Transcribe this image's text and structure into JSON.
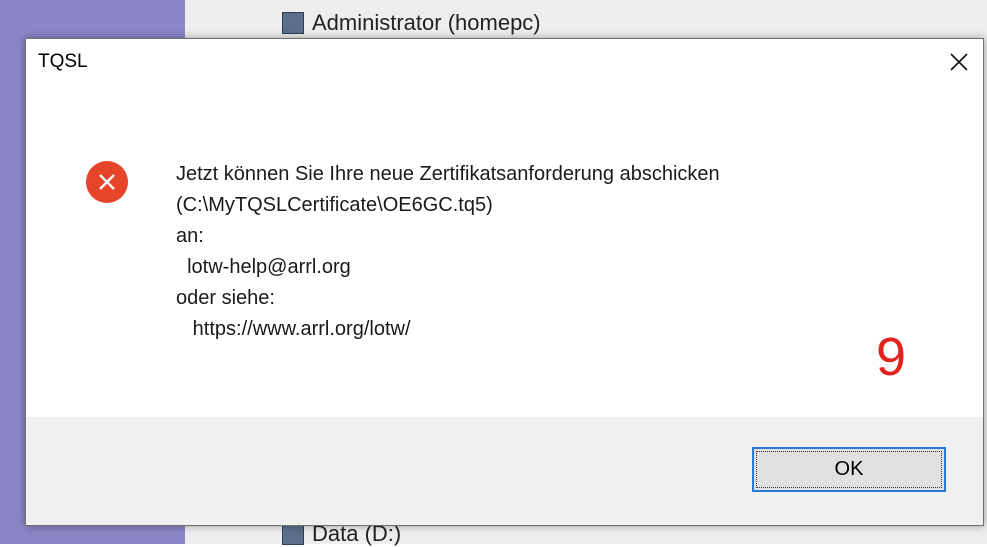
{
  "background": {
    "top_item": {
      "label": "Administrator (homepc)",
      "icon": "user-group-icon"
    },
    "bottom_item": {
      "label": "Data (D:)",
      "icon": "drive-icon"
    }
  },
  "dialog": {
    "title": "TQSL",
    "close_icon": "close-icon",
    "status_icon": "error-icon",
    "status_color": "#e6452a",
    "message_lines": [
      "Jetzt können Sie Ihre neue Zertifikatsanforderung abschicken",
      "(C:\\MyTQSLCertificate\\OE6GC.tq5)",
      "an:",
      "  lotw-help@arrl.org",
      "oder siehe:",
      "   https://www.arrl.org/lotw/"
    ],
    "annotation": "9",
    "annotation_color": "#e1231e",
    "ok_label": "OK",
    "accent": "#2a7ad4"
  }
}
